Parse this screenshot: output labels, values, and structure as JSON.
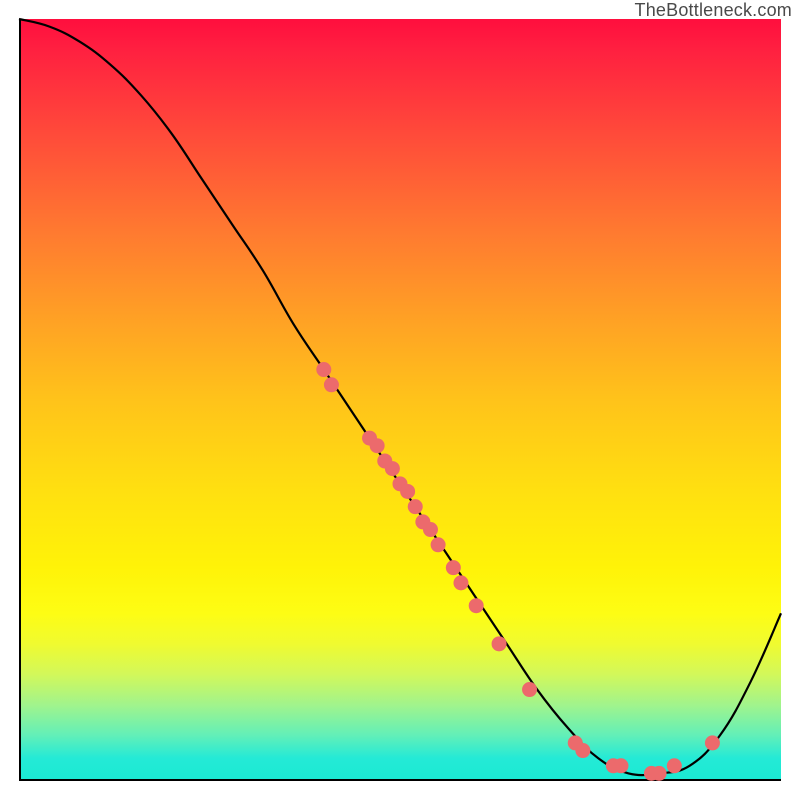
{
  "watermark": "TheBottleneck.com",
  "chart_data": {
    "type": "line",
    "title": "",
    "xlabel": "",
    "ylabel": "",
    "xlim": [
      0,
      100
    ],
    "ylim": [
      0,
      100
    ],
    "grid": false,
    "legend": false,
    "series": [
      {
        "name": "bottleneck-curve",
        "x": [
          0,
          4,
          8,
          12,
          16,
          20,
          24,
          28,
          32,
          36,
          40,
          44,
          48,
          52,
          56,
          60,
          64,
          68,
          72,
          76,
          80,
          84,
          88,
          92,
          96,
          100
        ],
        "y": [
          100,
          99,
          97,
          94,
          90,
          85,
          79,
          73,
          67,
          60,
          54,
          48,
          42,
          36,
          30,
          24,
          18,
          12,
          7,
          3,
          1,
          1,
          2,
          6,
          13,
          22
        ]
      }
    ],
    "scatter_points": {
      "name": "highlighted-points",
      "color": "#ec6a6c",
      "points": [
        {
          "x": 40,
          "y": 54
        },
        {
          "x": 41,
          "y": 52
        },
        {
          "x": 46,
          "y": 45
        },
        {
          "x": 47,
          "y": 44
        },
        {
          "x": 48,
          "y": 42
        },
        {
          "x": 49,
          "y": 41
        },
        {
          "x": 50,
          "y": 39
        },
        {
          "x": 51,
          "y": 38
        },
        {
          "x": 52,
          "y": 36
        },
        {
          "x": 53,
          "y": 34
        },
        {
          "x": 54,
          "y": 33
        },
        {
          "x": 55,
          "y": 31
        },
        {
          "x": 57,
          "y": 28
        },
        {
          "x": 58,
          "y": 26
        },
        {
          "x": 60,
          "y": 23
        },
        {
          "x": 63,
          "y": 18
        },
        {
          "x": 67,
          "y": 12
        },
        {
          "x": 73,
          "y": 5
        },
        {
          "x": 74,
          "y": 4
        },
        {
          "x": 78,
          "y": 2
        },
        {
          "x": 79,
          "y": 2
        },
        {
          "x": 83,
          "y": 1
        },
        {
          "x": 84,
          "y": 1
        },
        {
          "x": 86,
          "y": 2
        },
        {
          "x": 91,
          "y": 5
        }
      ]
    }
  }
}
